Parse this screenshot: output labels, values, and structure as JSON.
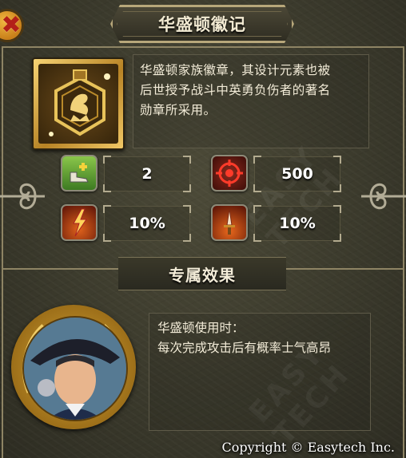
{
  "dialog": {
    "title": "华盛顿徽记",
    "close_icon": "close-icon",
    "description_lines": [
      "华盛顿家族徽章，其设计元素也被",
      "后世授予战斗中英勇负伤者的著名",
      "勋章所采用。"
    ]
  },
  "stats": [
    {
      "icon": "boot-plus-icon",
      "value": "2"
    },
    {
      "icon": "crosshair-target-icon",
      "value": "500"
    },
    {
      "icon": "lightning-burst-icon",
      "value": "10%"
    },
    {
      "icon": "flaming-sword-icon",
      "value": "10%"
    }
  ],
  "section": {
    "title": "专属效果",
    "effect_lines": [
      "华盛顿使用时：",
      "每次完成攻击后有概率士气高昂"
    ]
  },
  "watermark": "EASY TECH",
  "copyright": "Copyright © Easytech Inc.",
  "colors": {
    "panel": "#3b3a2c",
    "gold": "#d6a83a",
    "text": "#f3ecd8",
    "border": "#8e8464"
  }
}
